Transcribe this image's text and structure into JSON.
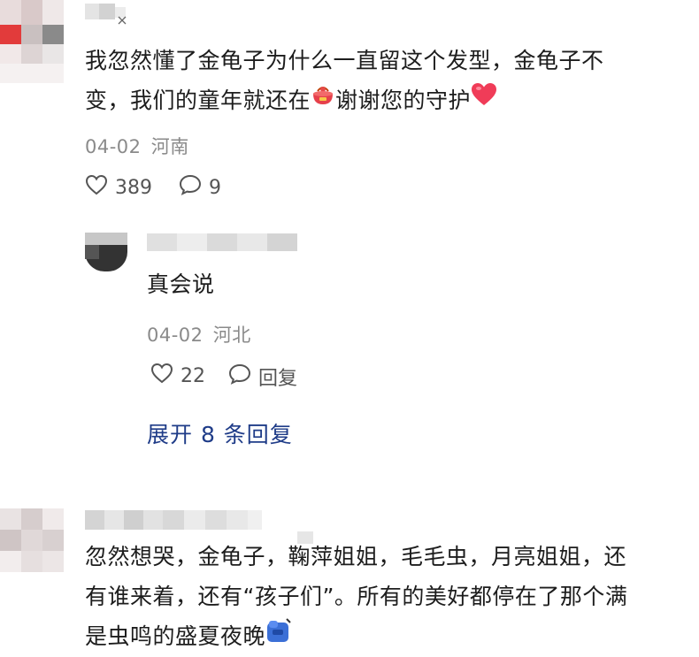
{
  "comments": [
    {
      "text_line1": "我忽然懂了金龟子为什么一直留这个发型，金龟子不",
      "text_line2a": "变，我们的童年就还在",
      "text_line2b": "谢谢您的守护",
      "date": "04-02",
      "location": "河南",
      "likes": "389",
      "replies": "9",
      "reply": {
        "text": "真会说",
        "date": "04-02",
        "location": "河北",
        "likes": "22",
        "reply_label": "回复"
      },
      "expand_label": "展开 8 条回复"
    },
    {
      "text_line1": "忽然想哭，金龟子，鞠萍姐姐，毛毛虫，月亮姐姐，还",
      "text_line2": "有谁来着，还有“孩子们”。所有的美好都停在了那个满",
      "text_line3": "是虫鸣的盛夏夜晚"
    }
  ],
  "icons": {
    "like": "heart-outline-icon",
    "comment": "speech-bubble-icon",
    "emoji_bag": "red-bag-emoji",
    "emoji_heart": "red-heart-emoji",
    "emoji_blue": "blue-bag-emoji"
  },
  "colors": {
    "text": "#1d1d1d",
    "meta": "#8a8a8a",
    "link": "#1f3c88",
    "heart": "#f0405c"
  }
}
